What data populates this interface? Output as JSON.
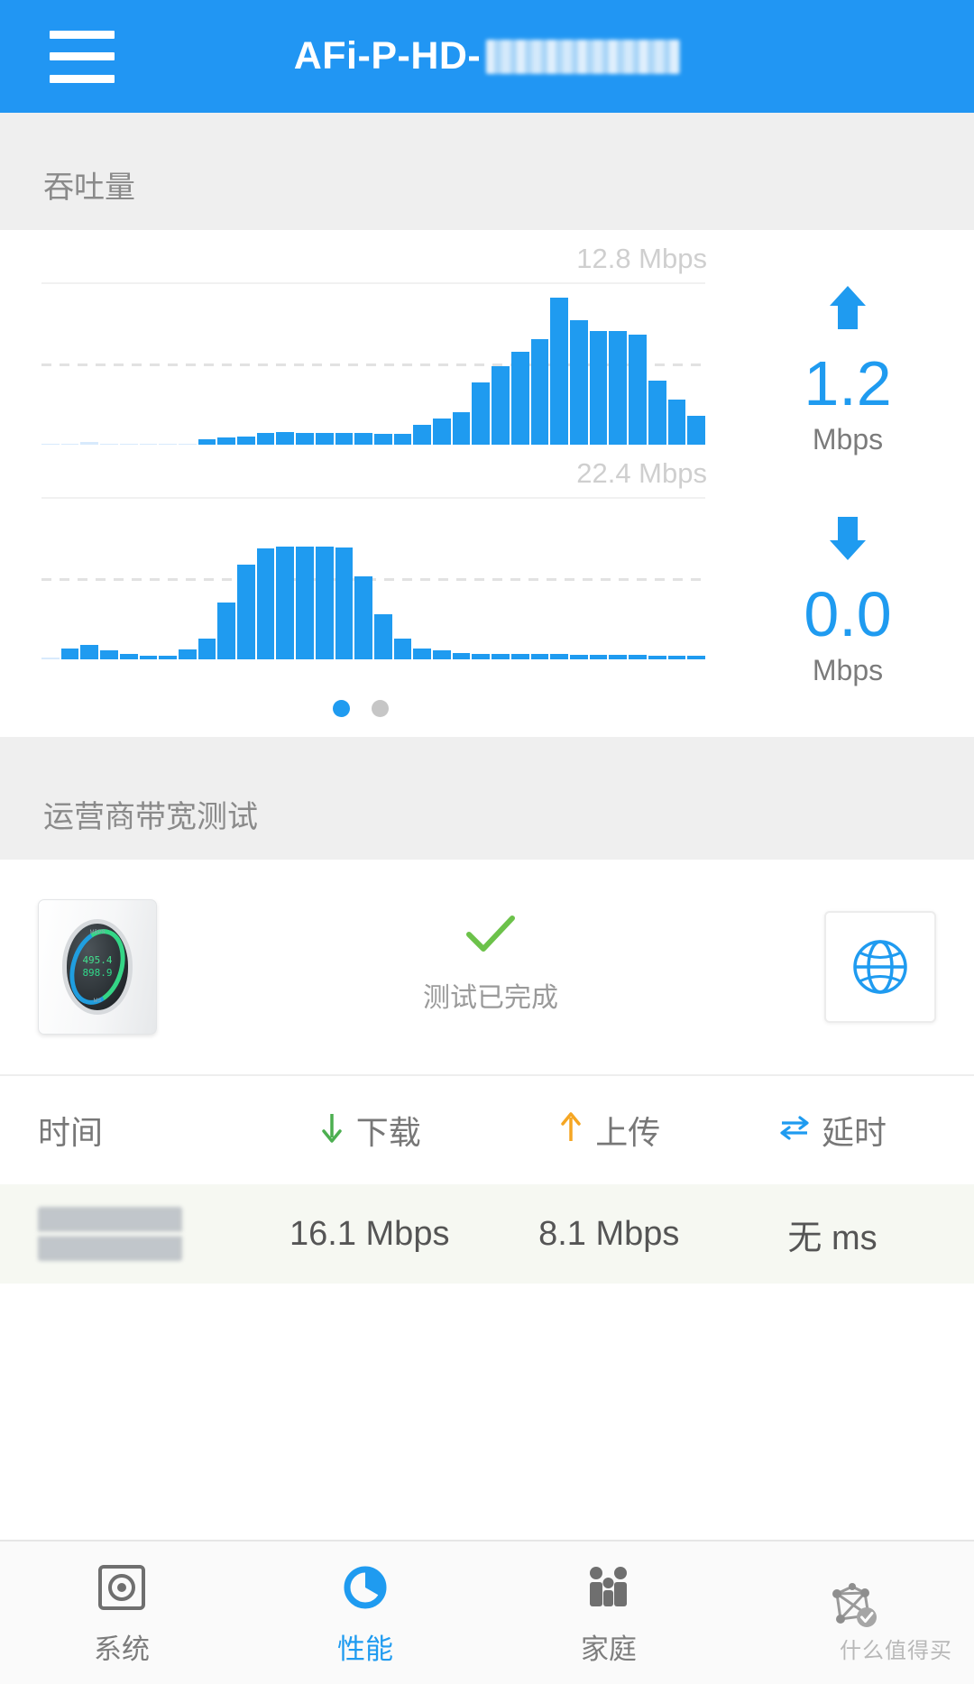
{
  "header": {
    "menu_icon": "hamburger-icon",
    "title_prefix": "AFi-P-HD-",
    "title_redacted": true,
    "bg_color": "#2196f3"
  },
  "sections": {
    "throughput_title": "吞吐量",
    "speedtest_title": "运营商带宽测试"
  },
  "throughput": {
    "upload": {
      "peak_label": "12.8 Mbps",
      "arrow_icon": "arrow-up-icon",
      "value": "1.2",
      "unit": "Mbps"
    },
    "download": {
      "peak_label": "22.4 Mbps",
      "arrow_icon": "arrow-down-icon",
      "value": "0.0",
      "unit": "Mbps"
    },
    "pager": {
      "total": 2,
      "active_index": 0
    }
  },
  "chart_data": [
    {
      "type": "bar",
      "title": "12.8 Mbps",
      "ylabel": "Mbps",
      "xlabel": "",
      "ylim": [
        0,
        12.8
      ],
      "grid": true,
      "gridlines": [
        12.8,
        6.4
      ],
      "legend": "upload",
      "values": [
        0.05,
        0.05,
        0.18,
        0.05,
        0.05,
        0.05,
        0.05,
        0.05,
        0.4,
        0.55,
        0.62,
        0.95,
        1.0,
        0.95,
        0.95,
        0.9,
        0.9,
        0.85,
        0.85,
        1.55,
        2.05,
        2.55,
        4.9,
        6.2,
        7.35,
        8.3,
        11.6,
        9.8,
        8.95,
        8.95,
        8.65,
        5.05,
        3.55,
        2.25
      ]
    },
    {
      "type": "bar",
      "title": "22.4 Mbps",
      "ylabel": "Mbps",
      "xlabel": "",
      "ylim": [
        0,
        22.4
      ],
      "grid": true,
      "gridlines": [
        22.4,
        11.2
      ],
      "legend": "download",
      "values": [
        0.25,
        1.45,
        1.95,
        1.3,
        0.7,
        0.55,
        0.5,
        1.35,
        2.85,
        7.9,
        13.1,
        15.3,
        15.55,
        15.6,
        15.55,
        15.45,
        11.4,
        6.2,
        2.85,
        1.55,
        1.25,
        0.85,
        0.8,
        0.8,
        0.75,
        0.75,
        0.7,
        0.65,
        0.65,
        0.6,
        0.6,
        0.55,
        0.55,
        0.45
      ]
    }
  ],
  "speedtest": {
    "device_icon": "amplifi-router-icon",
    "device_readout_top": "495.4",
    "device_readout_bottom": "898.9",
    "device_cap_top": "MBPS",
    "device_cap_bottom": "MS",
    "status_icon": "checkmark-icon",
    "status_text": "测试已完成",
    "internet_icon": "globe-icon"
  },
  "results_table": {
    "columns": [
      {
        "key": "time",
        "label": "时间",
        "icon": null
      },
      {
        "key": "down",
        "label": "下载",
        "icon": "arrow-down-icon",
        "icon_color": "#4caf50"
      },
      {
        "key": "up",
        "label": "上传",
        "icon": "arrow-up-icon",
        "icon_color": "#f5a623"
      },
      {
        "key": "latency",
        "label": "延时",
        "icon": "exchange-arrows-icon",
        "icon_color": "#1f9bf0"
      }
    ],
    "rows": [
      {
        "time": "",
        "time_redacted": true,
        "down": "16.1 Mbps",
        "up": "8.1 Mbps",
        "latency": "无 ms"
      }
    ]
  },
  "bottom_nav": {
    "active_index": 1,
    "items": [
      {
        "label": "系统",
        "icon": "system-square-icon"
      },
      {
        "label": "性能",
        "icon": "performance-donut-icon"
      },
      {
        "label": "家庭",
        "icon": "family-people-icon"
      },
      {
        "label": "",
        "icon": "network-mesh-icon"
      }
    ]
  },
  "watermark": "什么值得买",
  "colors": {
    "accent": "#1f9bf0",
    "header": "#2196f3",
    "section_bg": "#efefef",
    "download_green": "#4caf50",
    "upload_orange": "#f5a623",
    "check_green": "#6cc24a",
    "row_bg": "#f6f8f2"
  }
}
